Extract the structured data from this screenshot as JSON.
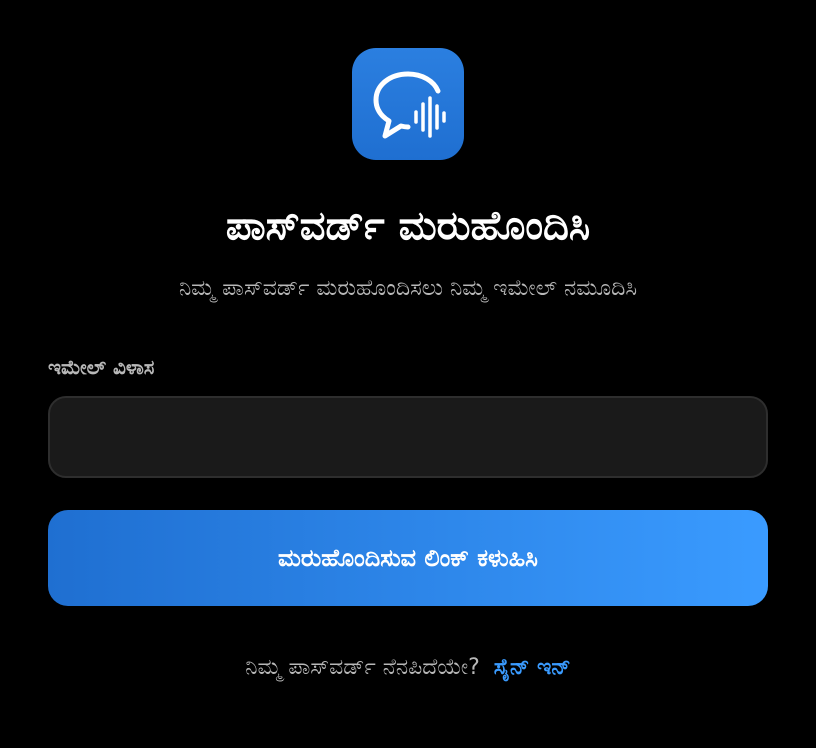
{
  "app_icon": {
    "name": "chat-voice-icon",
    "color": "#1f6fd1"
  },
  "title": "ಪಾಸ್‌ವರ್ಡ್ ಮರುಹೊಂದಿಸಿ",
  "subtitle": "ನಿಮ್ಮ ಪಾಸ್‌ವರ್ಡ್ ಮರುಹೊಂದಿಸಲು ನಿಮ್ಮ ಇಮೇಲ್ ನಮೂದಿಸಿ",
  "form": {
    "email_label": "ಇಮೇಲ್ ವಿಳಾಸ",
    "email_value": "",
    "email_placeholder": "",
    "submit_label": "ಮರುಹೊಂದಿಸುವ ಲಿಂಕ್ ಕಳುಹಿಸಿ"
  },
  "footer": {
    "prompt": "ನಿಮ್ಮ ಪಾಸ್‌ವರ್ಡ್ ನೆನಪಿದೆಯೇ?",
    "signin_label": "ಸೈನ್ ಇನ್"
  },
  "colors": {
    "background": "#000000",
    "accent": "#3a9bff",
    "accent_dark": "#1f6fd1",
    "input_bg": "#1a1a1a",
    "muted_text": "#b8b8b8"
  }
}
